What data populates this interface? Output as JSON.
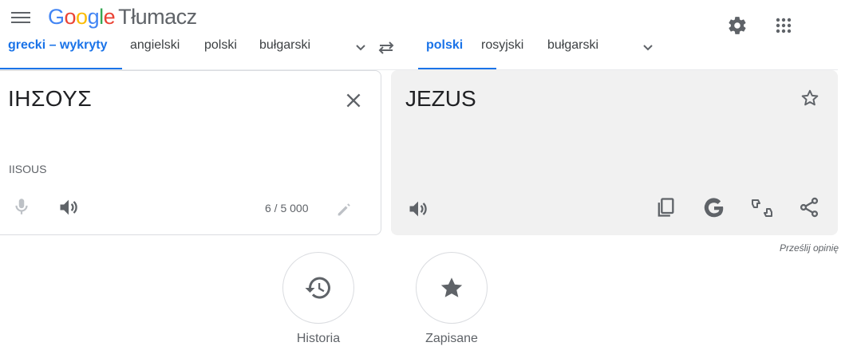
{
  "header": {
    "logo_letters": [
      "G",
      "o",
      "o",
      "g",
      "l",
      "e"
    ],
    "product_name": "Tłumacz",
    "icons": [
      "menu-icon",
      "settings-icon",
      "apps-icon"
    ]
  },
  "source_languages": {
    "tabs": [
      "grecki – wykryty",
      "angielski",
      "polski",
      "bułgarski"
    ],
    "active_index": 0
  },
  "target_languages": {
    "tabs": [
      "polski",
      "rosyjski",
      "bułgarski"
    ],
    "active_index": 0
  },
  "source": {
    "text": "ΙΗΣΟΥΣ",
    "transliteration": "IISOUS",
    "char_count": "6 / 5 000"
  },
  "target": {
    "text": "JEZUS"
  },
  "feedback_link": "Prześlij opinię",
  "bottom_buttons": [
    {
      "label": "Historia",
      "icon": "history-icon"
    },
    {
      "label": "Zapisane",
      "icon": "star-filled-icon"
    }
  ],
  "colors": {
    "accent": "#1a73e8",
    "icon_gray": "#5f6368",
    "panel_bg": "#f1f1f1",
    "border": "#dadce0"
  }
}
